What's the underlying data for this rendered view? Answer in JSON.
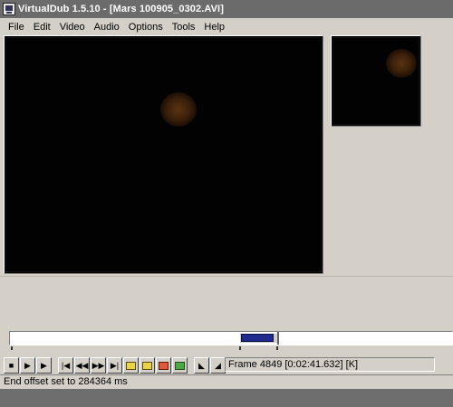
{
  "window": {
    "title": "VirtualDub 1.5.10 - [Mars 100905_0302.AVI]"
  },
  "menu": [
    "File",
    "Edit",
    "Video",
    "Audio",
    "Options",
    "Tools",
    "Help"
  ],
  "timeline": {
    "position_fraction": 0.55
  },
  "toolbar": {
    "buttons": [
      {
        "icon": "stop-icon",
        "glyph": "■"
      },
      {
        "icon": "play-input-icon",
        "glyph": "▶"
      },
      {
        "icon": "play-output-icon",
        "glyph": "▶"
      },
      {
        "icon": "start-icon",
        "glyph": "|◀"
      },
      {
        "icon": "prev-frame-icon",
        "glyph": "◀◀"
      },
      {
        "icon": "next-frame-icon",
        "glyph": "▶▶"
      },
      {
        "icon": "end-icon",
        "glyph": "▶|"
      },
      {
        "icon": "prev-keyframe-icon",
        "glyph": ""
      },
      {
        "icon": "next-keyframe-icon",
        "glyph": ""
      },
      {
        "icon": "scene-back-icon",
        "glyph": ""
      },
      {
        "icon": "scene-forward-icon",
        "glyph": ""
      },
      {
        "icon": "mark-in-icon",
        "glyph": "◣"
      },
      {
        "icon": "mark-out-icon",
        "glyph": "◢"
      }
    ]
  },
  "frame_readout": "Frame 4849 [0:02:41.632] [K]",
  "status": "End offset set to 284364 ms"
}
